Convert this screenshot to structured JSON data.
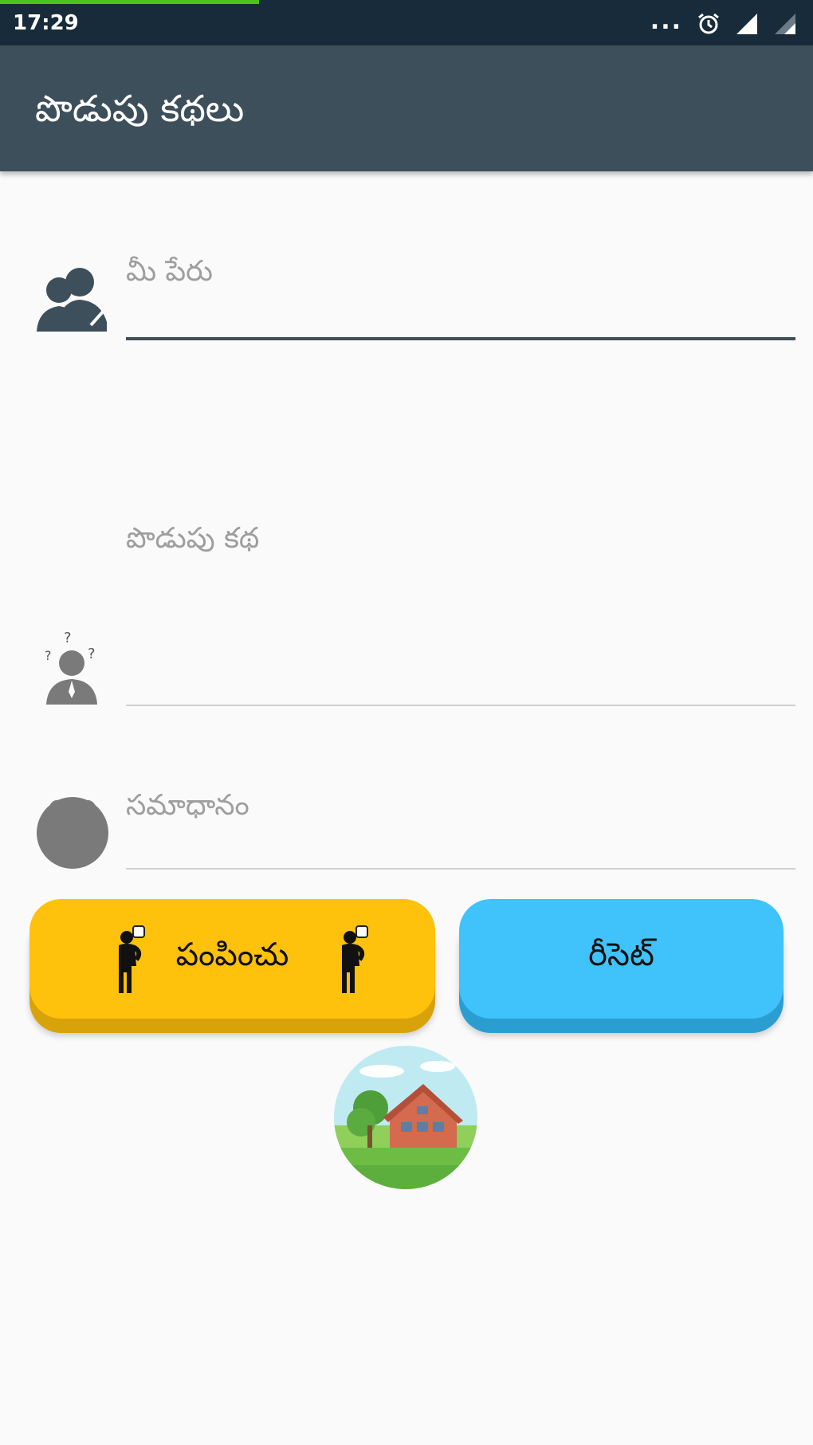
{
  "status_bar": {
    "time": "17:29",
    "more": "..."
  },
  "app_bar": {
    "title": "పొడుపు కథలు"
  },
  "form": {
    "name_placeholder": "మీ పేరు",
    "riddle_placeholder": "పొడుపు కథ",
    "answer_placeholder": "సమాధానం"
  },
  "buttons": {
    "send_label": "పంపించు",
    "reset_label": "రీసెట్"
  },
  "icons": {
    "name": "users-icon",
    "riddle": "thinking-person-icon",
    "answer": "avatar-circle-icon",
    "send_left": "thinking-figure-icon",
    "send_right": "thinking-figure-icon",
    "image": "house-landscape-icon"
  },
  "colors": {
    "app_bar": "#3d4f5a",
    "status_bar": "#172b3a",
    "send_button": "#fec10c",
    "reset_button": "#40c2fb",
    "accent_underline": "#3d4f5a"
  }
}
